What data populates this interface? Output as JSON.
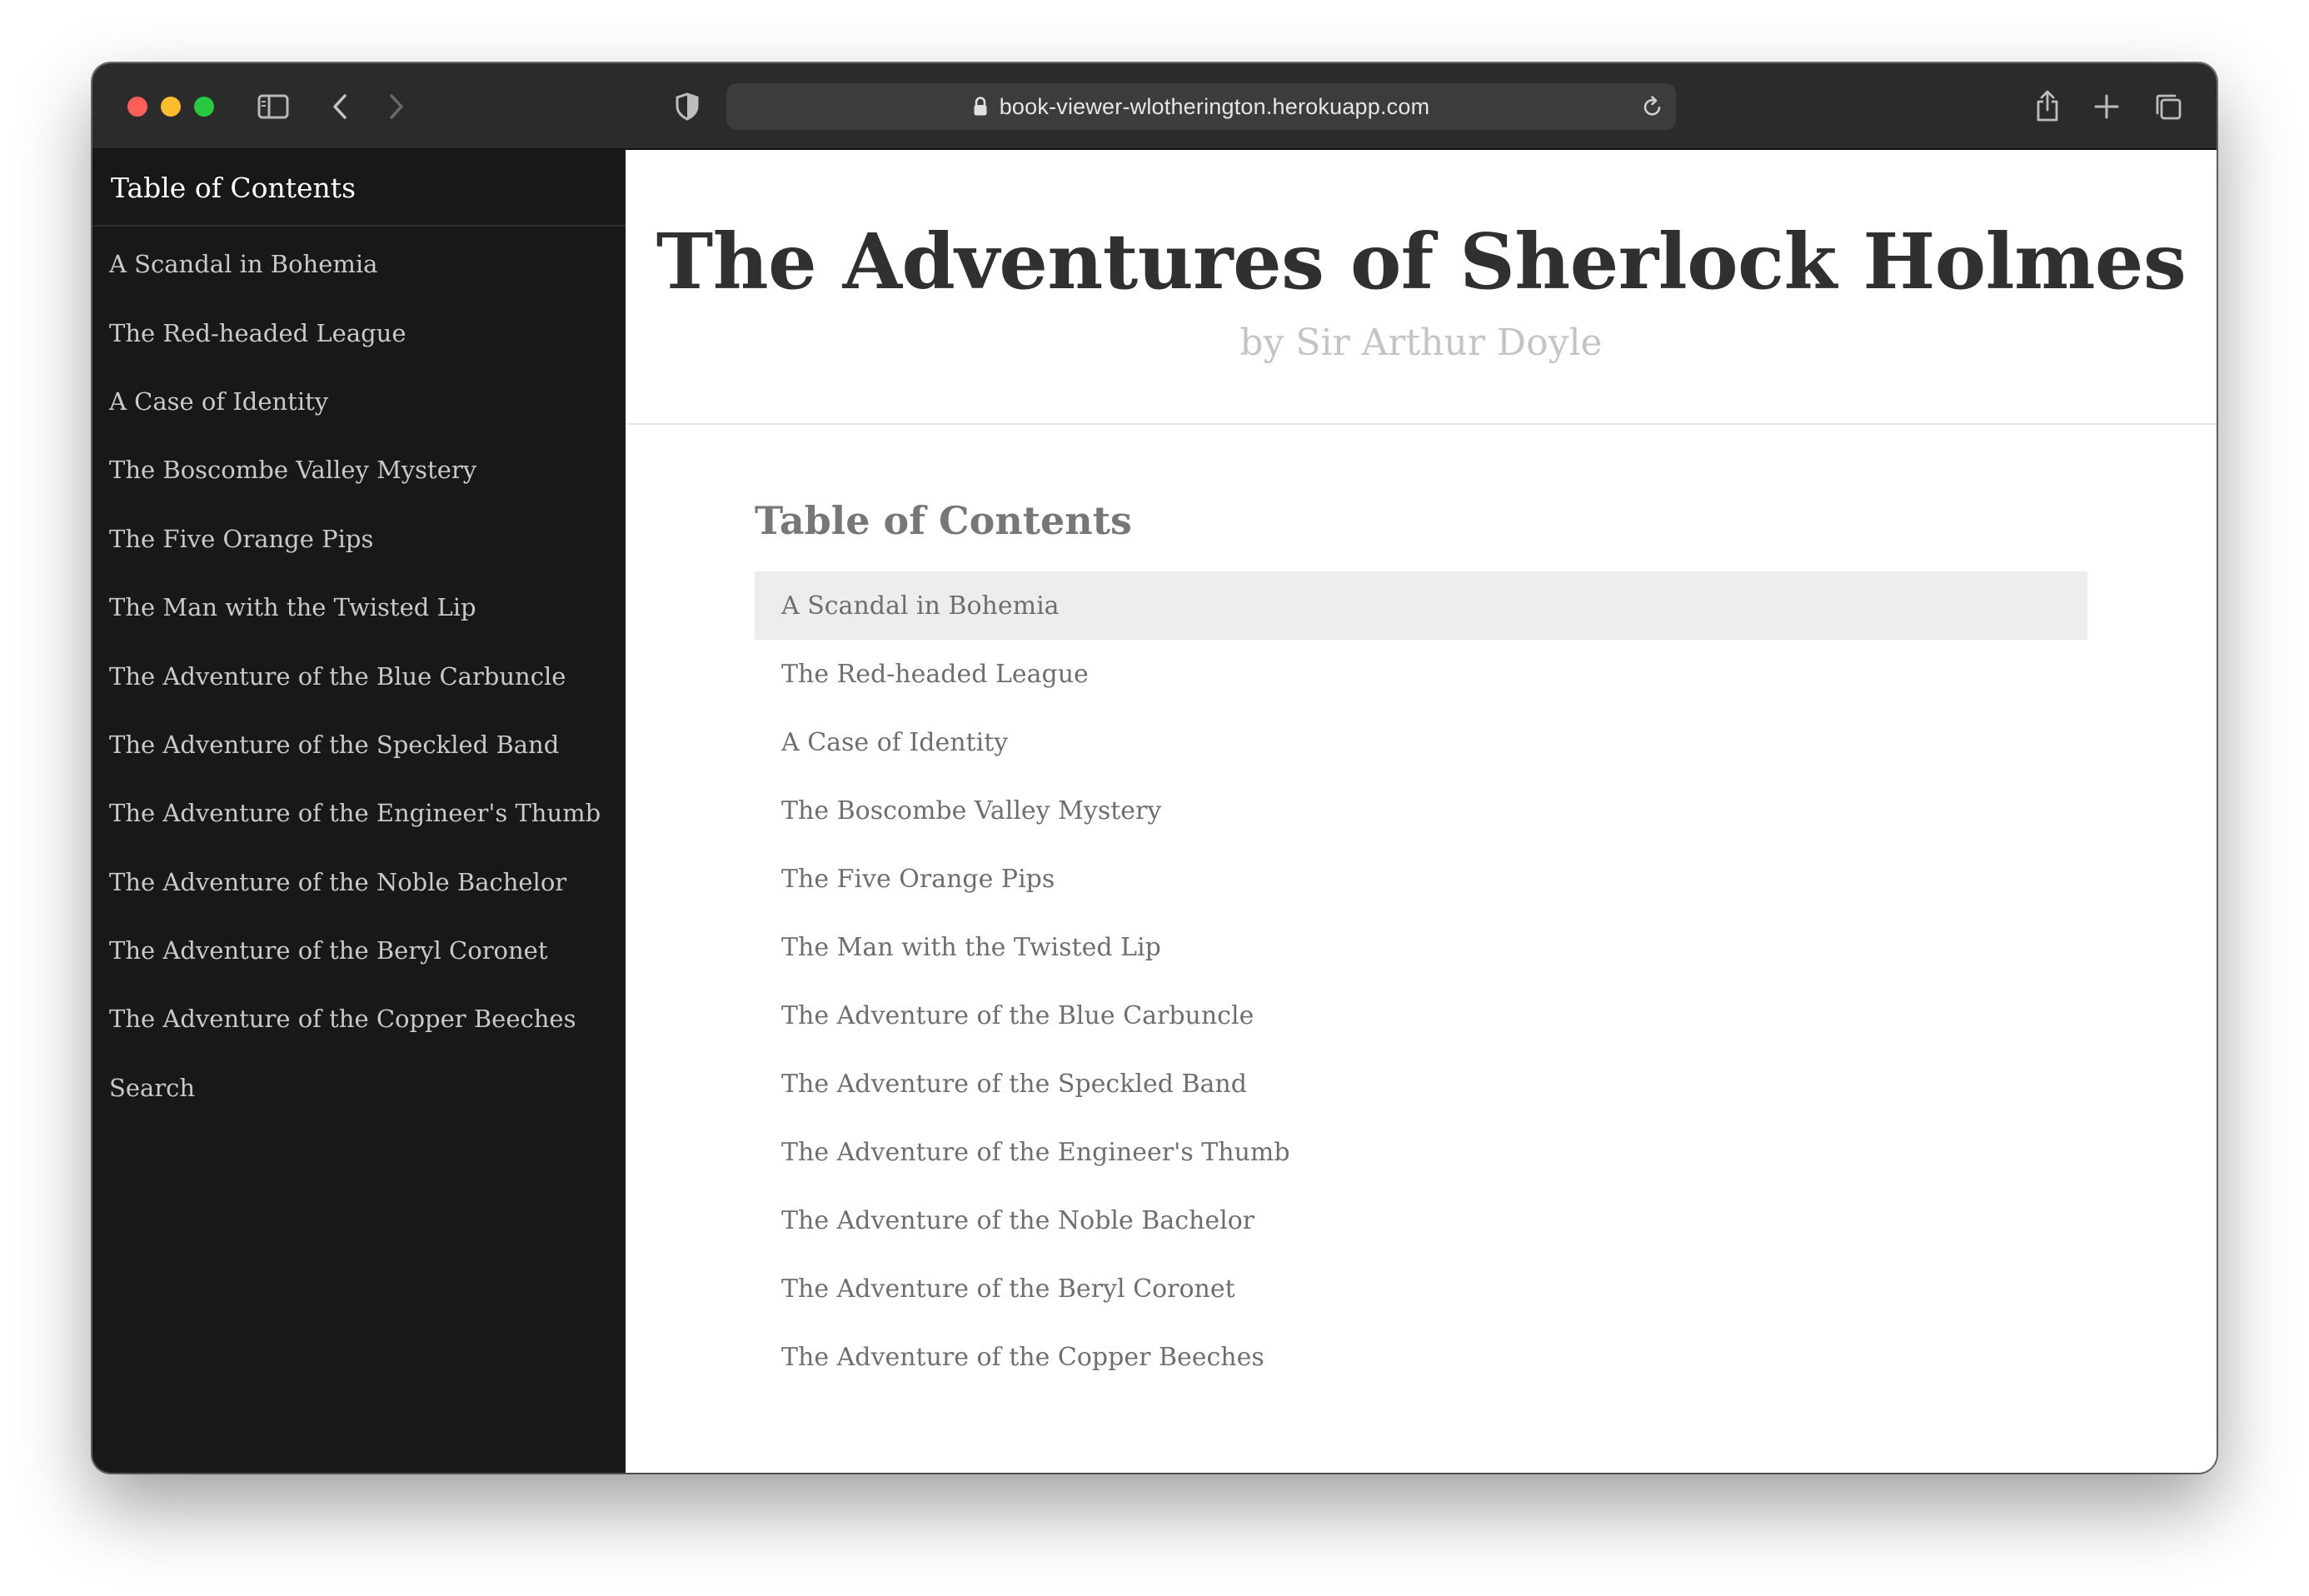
{
  "browser": {
    "url": "book-viewer-wlotherington.herokuapp.com",
    "icons": {
      "sidebar_toggle": "sidebar-toggle-icon",
      "back": "chevron-left-icon",
      "forward": "chevron-right-icon",
      "privacy": "shield-icon",
      "lock": "lock-icon",
      "reload": "reload-icon",
      "share": "share-icon",
      "new_tab": "plus-icon",
      "tabs": "tab-overview-icon"
    }
  },
  "sidebar": {
    "title": "Table of Contents",
    "items": [
      {
        "label": "A Scandal in Bohemia"
      },
      {
        "label": "The Red-headed League"
      },
      {
        "label": "A Case of Identity"
      },
      {
        "label": "The Boscombe Valley Mystery"
      },
      {
        "label": "The Five Orange Pips"
      },
      {
        "label": "The Man with the Twisted Lip"
      },
      {
        "label": "The Adventure of the Blue Carbuncle"
      },
      {
        "label": "The Adventure of the Speckled Band"
      },
      {
        "label": "The Adventure of the Engineer's Thumb"
      },
      {
        "label": "The Adventure of the Noble Bachelor"
      },
      {
        "label": "The Adventure of the Beryl Coronet"
      },
      {
        "label": "The Adventure of the Copper Beeches"
      },
      {
        "label": "Search"
      }
    ]
  },
  "main": {
    "title": "The Adventures of Sherlock Holmes",
    "author": "by Sir Arthur Doyle",
    "toc_heading": "Table of Contents",
    "chapters": [
      {
        "label": "A Scandal in Bohemia",
        "active": true
      },
      {
        "label": "The Red-headed League"
      },
      {
        "label": "A Case of Identity"
      },
      {
        "label": "The Boscombe Valley Mystery"
      },
      {
        "label": "The Five Orange Pips"
      },
      {
        "label": "The Man with the Twisted Lip"
      },
      {
        "label": "The Adventure of the Blue Carbuncle"
      },
      {
        "label": "The Adventure of the Speckled Band"
      },
      {
        "label": "The Adventure of the Engineer's Thumb"
      },
      {
        "label": "The Adventure of the Noble Bachelor"
      },
      {
        "label": "The Adventure of the Beryl Coronet"
      },
      {
        "label": "The Adventure of the Copper Beeches"
      }
    ]
  },
  "colors": {
    "sidebar_bg": "#181818",
    "toolbar_bg": "#2b2b2b",
    "active_row_bg": "#ededed"
  }
}
